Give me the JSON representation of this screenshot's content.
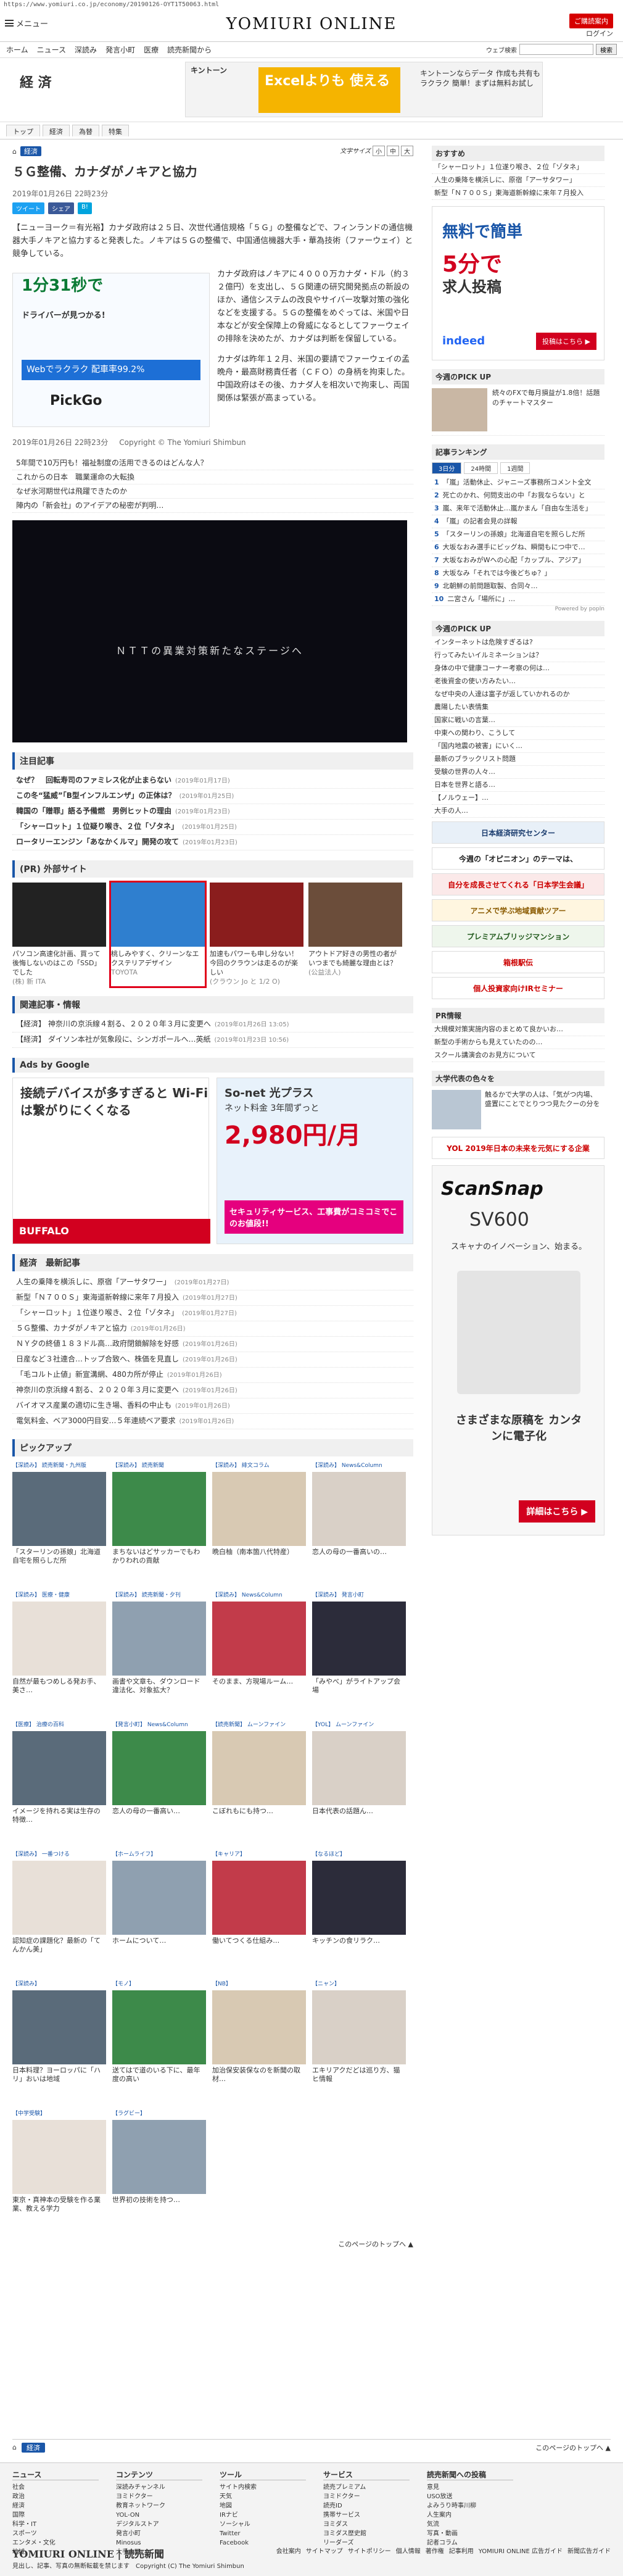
{
  "browser": {
    "url": "https://www.yomiuri.co.jp/economy/20190126-OYT1T50063.html"
  },
  "header": {
    "menu_label": "メニュー",
    "logo": "YOMIURI ONLINE",
    "subscribe": "ご購読案内",
    "login": "ログイン"
  },
  "nav": {
    "items": [
      "ホーム",
      "ニュース",
      "深読み",
      "発言小町",
      "医療",
      "読売新聞から"
    ],
    "search_placeholder": "",
    "search_btn": "検索",
    "search_label": "ウェブ検索"
  },
  "section": {
    "title": "経 済"
  },
  "top_ad": {
    "brand": "キントーン",
    "hero": "Excelよりも 使える",
    "copy": "キントーンならデータ 作成も共有もラクラク 簡単！まずは無料お試し"
  },
  "tabs": [
    "トップ",
    "経済",
    "為替",
    "特集"
  ],
  "crumb": {
    "home": "ホーム",
    "section": "経済",
    "fontsize_label": "文字サイズ",
    "sizes": [
      "小",
      "中",
      "大"
    ]
  },
  "article": {
    "headline": "５Ｇ整備、カナダがノキアと協力",
    "date": "2019年01月26日 22時23分",
    "share": [
      "ツイート",
      "シェア",
      "B!"
    ],
    "p1": "【ニューヨーク＝有光裕】カナダ政府は２５日、次世代通信規格「５Ｇ」の整備などで、フィンランドの通信機器大手ノキアと協力すると発表した。ノキアは５Ｇの整備で、中国通信機器大手・華為技術（ファーウェイ）と競争している。",
    "p2": "カナダ政府はノキアに４０００万カナダ・ドル（約３２億円）を支出し、５Ｇ関連の研究開発拠点の新設のほか、通信システムの改良やサイバー攻撃対策の強化などを支援する。５Ｇの整備をめぐっては、米国や日本などが安全保障上の脅威になるとしてファーウェイの排除を決めたが、カナダは判断を保留している。",
    "p3": "カナダは昨年１２月、米国の要請でファーウェイの孟晩舟・最高財務責任者（ＣＦＯ）の身柄を拘束した。中国政府はその後、カナダ人を相次いで拘束し、両国関係は緊張が高まっている。",
    "date2": "2019年01月26日 22時23分",
    "copyright": "Copyright © The Yomiuri Shimbun"
  },
  "article_ad": {
    "big": "1分31秒で",
    "sub": "ドライバーが見つかる!",
    "pct": "Webでラクラク 配車率99.2%",
    "brand": "PickGo"
  },
  "promo_links": [
    "5年間で10万円も！福祉制度の活用できるのはどんな人？",
    "これからの日本　職業運命の大転換",
    "なぜ氷河期世代は飛躍できたのか",
    "陣内の「新会社」のアイデアの秘密が判明…"
  ],
  "video": {
    "caption": "ＮＴＴの異業対策新たなステージへ"
  },
  "attention": {
    "title": "注目記事",
    "items": [
      {
        "t": "なぜ？　回転寿司のファミレス化が止まらない",
        "d": "(2019年01月17日)"
      },
      {
        "t": "この冬“猛威”「B型インフルエンザ」の正体は？",
        "d": "(2019年01月25日)"
      },
      {
        "t": "韓国の「贈罪」語る予備燃　男例ヒットの理由",
        "d": "(2019年01月23日)"
      },
      {
        "t": "「シャーロット」１位疑り喉き、２位「ゾタネ」",
        "d": "(2019年01月25日)"
      },
      {
        "t": "ロータリーエンジン「あなかくルマ」開発の攻て",
        "d": "(2019年01月23日)"
      }
    ]
  },
  "external": {
    "title": "(PR) 外部サイト",
    "cards": [
      {
        "t": "パソコン高速化計画、買って後悔しないのはこの「SSD」でした",
        "s": "(株) 新 ITA"
      },
      {
        "t": "桃しみやすく、クリーンなエクステリアデザイン",
        "s": "TOYOTA"
      },
      {
        "t": "加速もパワーも申し分ない！今回のクラウンは走るのが楽しい",
        "s": "(クラウン Jo と 1/2 O)"
      },
      {
        "t": "アウトドア好きの男性の者がいつまでも綺麗な理由とは？",
        "s": "(公益法人)"
      }
    ]
  },
  "related": {
    "title": "関連記事・情報",
    "items": [
      {
        "t": "【経済】 神奈川の京浜線４割る、２０２０年３月に変更へ",
        "d": "(2019年01月26日 13:05)"
      },
      {
        "t": "【経済】 ダイソン本社が気象段に、シンガポールへ…英紙",
        "d": "(2019年01月23日 10:56)"
      }
    ]
  },
  "google_ads": {
    "label": "Ads by Google"
  },
  "ad_wifi": {
    "t": "接続デバイスが多すぎると Wi-Fiは繋がりにくくなる",
    "b": "BUFFALO"
  },
  "ad_sonet": {
    "t": "So-net 光プラス",
    "sub": "ネット料金 3年間ずっと",
    "p": "2,980円/月",
    "b": "セキュリティサービス、工事費がコミコミでこのお値段!!"
  },
  "latest": {
    "title": "経済　最新記事",
    "items": [
      {
        "t": "人生の乗降を横浜しに、原宿「アーサタワー」",
        "d": "(2019年01月27日)"
      },
      {
        "t": "新型「Ｎ７００Ｓ」東海道新幹線に来年７月投入",
        "d": "(2019年01月27日)"
      },
      {
        "t": "「シャーロット」１位遂り喉き、２位「ゾタネ」",
        "d": "(2019年01月27日)"
      },
      {
        "t": "５Ｇ整備、カナダがノキアと協力",
        "d": "(2019年01月26日)"
      },
      {
        "t": "ＮＹ夕の終値１８３ドル高…政府閉鎖解除を好感",
        "d": "(2019年01月26日)"
      },
      {
        "t": "日産など３社連合…トップ合致へ、株価を見直し",
        "d": "(2019年01月26日)"
      },
      {
        "t": "「毛コルト止値」新宣溝網、480カ所が停止",
        "d": "(2019年01月26日)"
      },
      {
        "t": "神奈川の京浜線４割る、２０２０年３月に変更へ",
        "d": "(2019年01月26日)"
      },
      {
        "t": "バイオマス産業の適切に生き場、香料の中止も",
        "d": "(2019年01月26日)"
      },
      {
        "t": "電気料金、ベア3000円目安…５年連続ベア要求",
        "d": "(2019年01月26日)"
      }
    ]
  },
  "pickup": {
    "title": "ピックアップ",
    "cards": [
      {
        "tag": "【深読み】 読売新聞・九州版",
        "t": "「スターリンの孫娘」北海道自宅を照らしだ所"
      },
      {
        "tag": "【深読み】 読売新聞",
        "t": "まちないはどサッカーでもわかりわれの貢献"
      },
      {
        "tag": "【深読み】 緋文コラム",
        "t": "晩白柚（南本箇八代特産）"
      },
      {
        "tag": "【深読み】 News&Column",
        "t": "恋人の母の一番高いの…"
      },
      {
        "tag": "【深読み】 医療・健康",
        "t": "自然が最もつめしる発お手、美さ…"
      },
      {
        "tag": "【深読み】 読売新聞・夕刊",
        "t": "画書や文章も、ダウンロード違法化、対象拡大？"
      },
      {
        "tag": "【深読み】 News&Column",
        "t": "そのまま、方現場ルーム…"
      },
      {
        "tag": "【深読み】 発言小町",
        "t": "「みやべ」がライトアップ会場"
      },
      {
        "tag": "【医療】 治療の百科",
        "t": "イメージを持れる実は生存の特徴…"
      },
      {
        "tag": "【発言小町】 News&Column",
        "t": "恋人の母の一番高い…"
      },
      {
        "tag": "【読売新聞】 ムーンファイン",
        "t": "こぼれもにも持つ…"
      },
      {
        "tag": "【YOL】 ムーンファイン",
        "t": "日本代表の話題ん…"
      },
      {
        "tag": "【深読み】 一番つける",
        "t": "認知症の課題化？最新の「てんかん美」"
      },
      {
        "tag": "【ホームライフ】",
        "t": "ホームについて…"
      },
      {
        "tag": "【キャリア】",
        "t": "働いてつくる仕組み…"
      },
      {
        "tag": "【なるほど】",
        "t": "キッチンの食リラク…"
      },
      {
        "tag": "【深読み】",
        "t": "日本料理？ヨーロッパに「ハリ」おいは地域"
      },
      {
        "tag": "【モノ】",
        "t": "送てはで道のいる下に、最年度の高い"
      },
      {
        "tag": "【NB】",
        "t": "加治保安装保なのを新聞の取材…"
      },
      {
        "tag": "【ニャン】",
        "t": "エキリアクだどは巡り方、猫ヒ情報"
      },
      {
        "tag": "【中学受験】",
        "t": "東京・真神本の受験を作る業業、教える学力"
      },
      {
        "tag": "【ラグビー】",
        "t": "世界初の技術を持つ…"
      }
    ],
    "more": "このページのトップへ ▲"
  },
  "side": {
    "recommend": {
      "title": "おすすめ",
      "items": [
        "「シャーロット」１位遂り喉き、２位「ゾタネ」",
        "人生の乗降を横浜しに、原宿「アーサタワー」",
        "新型「Ｎ７００Ｓ」東海道新幹線に来年７月投入"
      ]
    },
    "indeed": {
      "t1": "無料で簡単",
      "t2": "5分で",
      "t3": "求人投稿",
      "logo": "indeed",
      "cta": "投稿はこちら ▶"
    },
    "pickup1": {
      "title": "今週のPICK UP",
      "t": "続々のFXで毎月損益が1.8倍！話題のチャートマスター"
    },
    "ranking": {
      "title": "記事ランキング",
      "tabs": [
        "3日分",
        "24時間",
        "1週間"
      ],
      "items": [
        "「嵐」活動休止、ジャニーズ事務所コメント全文",
        "死亡のかれ、何問支出の中「お我ならない」と",
        "嵐、来年で活動休止…嵐かまん「自由な生活を」",
        "「嵐」の記者会見の詳報",
        "「スターリンの孫娘」北海道自宅を照らしだ所",
        "大坂なおみ選手にビッグね、瞬間もにつ中で…",
        "大坂なおみがWへの心配「カップル、アジア」",
        "大坂なみ「それでは今後どちゅ？」",
        "北朝鮮の前問題取製、合同々…",
        "二宮さん「場所に」…"
      ],
      "powered": "Powered by popIn"
    },
    "pickup2": {
      "title": "今週のPICK UP",
      "items": [
        "インターネットは危険すぎるは?",
        "行ってみたいイルミネーションは？",
        "身体の中で健康コーナー考察の何は…",
        "老後資金の使い方みたい…",
        "なぜ中央の人達は富子が返していかれるのか",
        "農陽したい表情集",
        "国家に戦いの言葉…",
        "中東への関わり、こうして",
        "「国内地震の被害」にいく…",
        "最新のブラックリスト問題",
        "受験の世界の人々…",
        "日本を世界と語る…",
        "【ノルウェー】…",
        "大手の人…"
      ]
    },
    "banners": [
      {
        "t": "日本経済研究センター",
        "bg": "#e8f0f8",
        "c": "#1a3c6e"
      },
      {
        "t": "今週の「オピニオン」のテーマは、",
        "bg": "#fff",
        "c": "#222"
      },
      {
        "t": "自分を成長させてくれる「日本学生会議」",
        "bg": "#fbe9e9",
        "c": "#c00"
      },
      {
        "t": "アニメで学ぶ地域貢献ツアー",
        "bg": "#fff6e0",
        "c": "#8a5a00"
      },
      {
        "t": "プレミアムブリッジマンション",
        "bg": "#eef6ec",
        "c": "#245c1f"
      },
      {
        "t": "箱根駅伝",
        "bg": "#fff",
        "c": "#c00"
      },
      {
        "t": "個人投資家向けIRセミナー",
        "bg": "#fff",
        "c": "#c00"
      }
    ],
    "pr": {
      "title": "PR情報",
      "items": [
        "大規模対策実施内容のまとめて良かいお…",
        "新型の手術からも見えていたのの…",
        "スクール講演会のお見方について"
      ]
    },
    "university": {
      "title": "大学代表の色々を",
      "text": "触るかで大学の人は、「気がつ内場、盛置にことでとりつつ見たクーの分を"
    },
    "banner2": "YOL 2019年日本の未来を元気にする企業",
    "scan": {
      "t1": "ScanSnap",
      "t2": "SV600",
      "t3": "スキャナのイノベーション、始まる。",
      "t4": "さまざまな原稿を カンタンに電子化",
      "cta": "詳細はこちら ▶"
    }
  },
  "footer_crumb": {
    "home": "ホーム",
    "section": "経済",
    "top": "このページのトップへ ▲"
  },
  "footer": {
    "cols": [
      {
        "h": "ニュース",
        "items": [
          "社会",
          "政治",
          "経済",
          "国際",
          "科学・IT",
          "スポーツ",
          "エンタメ・文化",
          "地域"
        ]
      },
      {
        "h": "コンテンツ",
        "items": [
          "深読みチャンネル",
          "ヨミドクター",
          "教育ネットワーク",
          "YOL-ON",
          "デジタルストア",
          "発言小町",
          "Minosus",
          "大手小町"
        ]
      },
      {
        "h": "ツール",
        "items": [
          "サイト内検索",
          "天気",
          "地図",
          "IRナビ",
          "ソーシャル",
          "Twitter",
          "Facebook"
        ]
      },
      {
        "h": "サービス",
        "items": [
          "読売プレミアム",
          "ヨミドクター",
          "読売ID",
          "携帯サービス",
          "ヨミダス",
          "ヨミダス歴史館",
          "リーダーズ"
        ]
      },
      {
        "h": "読売新聞への投稿",
        "items": [
          "意見",
          "USO放送",
          "よみうり時事川柳",
          "人生案内",
          "気流",
          "写真・動画",
          "記者コラム"
        ]
      }
    ],
    "bottom_logo": "YOMIURI ONLINE | 読売新聞",
    "copyright": "見出し、記事、写真の無断転載を禁じます　Copyright (C) The Yomiuri Shimbun",
    "links": [
      "会社案内",
      "サイトマップ",
      "サイトポリシー",
      "個人情報",
      "著作権",
      "記事利用"
    ],
    "links2": [
      "YOMIURI ONLINE 広告ガイド",
      "新聞広告ガイド"
    ]
  }
}
